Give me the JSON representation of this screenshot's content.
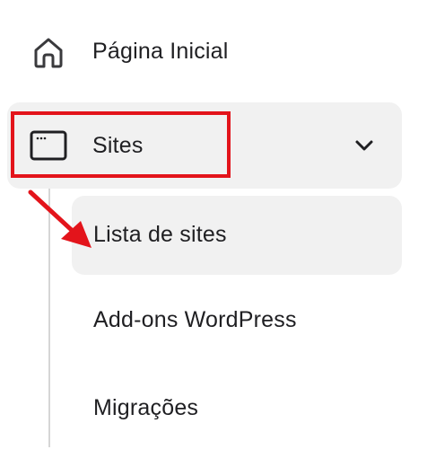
{
  "nav": {
    "home": {
      "label": "Página Inicial",
      "icon": "home-icon"
    },
    "sites": {
      "label": "Sites",
      "icon": "browser-window-icon",
      "expanded": true
    },
    "sub_items": [
      {
        "label": "Lista de sites",
        "active": true
      },
      {
        "label": "Add-ons WordPress",
        "active": false
      },
      {
        "label": "Migrações",
        "active": false
      }
    ]
  },
  "annotation": {
    "highlight_color": "#e3141b"
  },
  "colors": {
    "active_background": "#f1f1f1",
    "text": "#1f1f22"
  }
}
